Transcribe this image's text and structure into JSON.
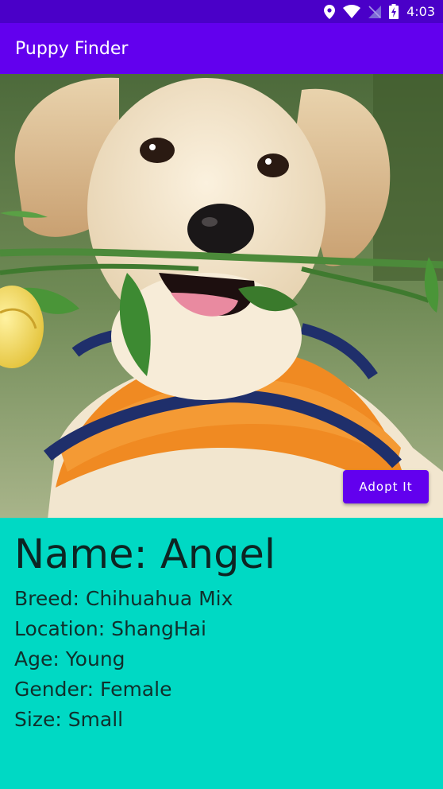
{
  "status_bar": {
    "time": "4:03",
    "icons": [
      "location-icon",
      "wifi-icon",
      "no-signal-icon",
      "battery-charging-icon"
    ]
  },
  "app_bar": {
    "title": "Puppy Finder"
  },
  "hero": {
    "image_subject": "puppy-photo",
    "adopt_label": "Adopt It"
  },
  "details": {
    "name": "Name: Angel",
    "breed": "Breed: Chihuahua Mix",
    "location": "Location: ShangHai",
    "age": "Age: Young",
    "gender": "Gender: Female",
    "size": "Size: Small"
  },
  "colors": {
    "status_bar": "#4a00c8",
    "app_bar": "#6200ee",
    "accent_button": "#6200ee",
    "details_background": "#00d9c4"
  }
}
